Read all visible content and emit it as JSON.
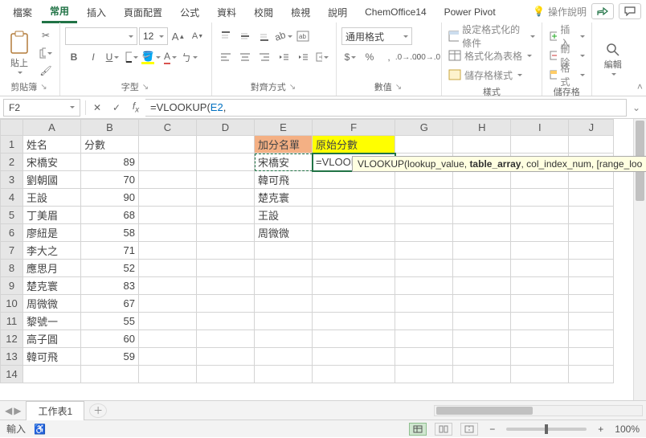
{
  "tabs": [
    "檔案",
    "常用",
    "插入",
    "頁面配置",
    "公式",
    "資料",
    "校閱",
    "檢視",
    "說明",
    "ChemOffice14",
    "Power Pivot"
  ],
  "active_tab_index": 1,
  "search_hint": "操作說明",
  "ribbon": {
    "clipboard": {
      "paste": "貼上",
      "label": "剪貼簿"
    },
    "font": {
      "name": "",
      "size": "12",
      "label": "字型"
    },
    "align": {
      "label": "對齊方式"
    },
    "number": {
      "format": "通用格式",
      "label": "數值"
    },
    "styles": {
      "cond": "設定格式化的條件",
      "table": "格式化為表格",
      "cell": "儲存格樣式",
      "label": "樣式"
    },
    "cells": {
      "ins": "插入",
      "del": "刪除",
      "fmt": "格式",
      "label": "儲存格"
    },
    "editing": {
      "label": "編輯"
    }
  },
  "namebox": "F2",
  "formula": {
    "prefix": "=VLOOKUP(",
    "arg": "E2",
    "suffix": ","
  },
  "tooltip": {
    "fn": "VLOOKUP",
    "a1": "lookup_value",
    "a2": "table_array",
    "a3": "col_index_num",
    "a4": "[range_loo"
  },
  "columns": [
    "A",
    "B",
    "C",
    "D",
    "E",
    "F",
    "G",
    "H",
    "I",
    "J"
  ],
  "rows": [
    1,
    2,
    3,
    4,
    5,
    6,
    7,
    8,
    9,
    10,
    11,
    12,
    13,
    14
  ],
  "cells": {
    "A1": "姓名",
    "B1": "分數",
    "E1": "加分名單",
    "F1": "原始分數",
    "A2": "宋橋安",
    "B2": "89",
    "E2": "宋橋安",
    "F2": "=VLOOKUP(E2,",
    "A3": "劉朝國",
    "B3": "70",
    "E3": "韓可飛",
    "A4": "王設",
    "B4": "90",
    "E4": "楚克寰",
    "A5": "丁美眉",
    "B5": "68",
    "E5": "王設",
    "A6": "廖紐是",
    "B6": "58",
    "E6": "周微微",
    "A7": "李大之",
    "B7": "71",
    "A8": "應思月",
    "B8": "52",
    "A9": "楚克寰",
    "B9": "83",
    "A10": "周微微",
    "B10": "67",
    "A11": "黎號一",
    "B11": "55",
    "A12": "高子圓",
    "B12": "60",
    "A13": "韓可飛",
    "B13": "59",
    "A14": "",
    "B14": ""
  },
  "sheet": {
    "name": "工作表1"
  },
  "status": {
    "mode": "輸入",
    "zoom": "100%"
  }
}
